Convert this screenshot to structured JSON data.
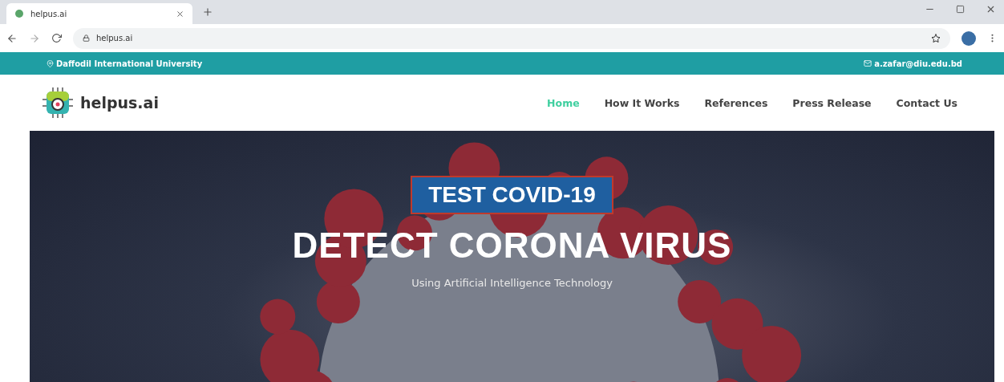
{
  "browser": {
    "tab_title": "helpus.ai",
    "url": "helpus.ai"
  },
  "topbar": {
    "location": "Daffodil International University",
    "email": "a.zafar@diu.edu.bd"
  },
  "header": {
    "logo_text": "helpus.ai",
    "nav": [
      {
        "label": "Home",
        "selected": true
      },
      {
        "label": "How It Works",
        "selected": false
      },
      {
        "label": "References",
        "selected": false
      },
      {
        "label": "Press Release",
        "selected": false
      },
      {
        "label": "Contact Us",
        "selected": false
      }
    ]
  },
  "hero": {
    "badge": "TEST COVID-19",
    "title": "DETECT CORONA VIRUS",
    "subtitle": "Using Artificial Intelligence Technology"
  }
}
